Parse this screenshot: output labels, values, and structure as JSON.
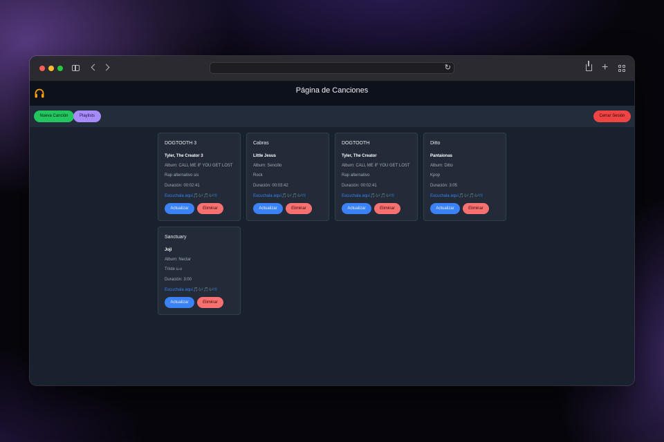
{
  "browser": {
    "traffic_lights": [
      "#fe5f57",
      "#febc2e",
      "#28c840"
    ],
    "address": "",
    "icons": [
      "sidebar-icon",
      "back-chevron-icon",
      "forward-chevron-icon",
      "reload-icon",
      "share-icon",
      "new-tab-icon",
      "tab-overview-icon"
    ]
  },
  "header": {
    "title": "Página de Canciones",
    "logo_icon": "headphones-icon",
    "logo_color": "#f59e0b"
  },
  "nav": {
    "new_song": "Nueva Canción",
    "playlists": "Playlists",
    "logout": "Cerrar Sesión"
  },
  "colors": {
    "new_song": "#22c55e",
    "playlists": "#a78bfa",
    "logout": "#ef4444",
    "update": "#3b82f6",
    "delete": "#f87171",
    "link": "#3b82f6"
  },
  "songs": [
    {
      "title": "DOGTOOTH 3",
      "artist": "Tyler, The Creator 3",
      "album": "Album: CALL ME IF YOU GET LOST",
      "genre": "Rap alternativo sis",
      "duration": "Duración: 00:02:41",
      "listen": "Escuchala aquí🎵🎶🎵🎶!!!",
      "update": "Actualizar",
      "delete": "Eliminar"
    },
    {
      "title": "Cabras",
      "artist": "Little Jesus",
      "album": "Album: Sencillo",
      "genre": "Rock",
      "duration": "Duración: 00:03:42",
      "listen": "Escuchala aquí🎵🎶🎵🎶!!!",
      "update": "Actualizar",
      "delete": "Eliminar"
    },
    {
      "title": "DOGTOOTH",
      "artist": "Tyler, The Creator",
      "album": "Album: CALL ME IF YOU GET LOST",
      "genre": "Rap alternativo",
      "duration": "Duración: 00:02:41",
      "listen": "Escuchala aquí🎵🎶🎵🎶!!!",
      "update": "Actualizar",
      "delete": "Eliminar"
    },
    {
      "title": "Ditto",
      "artist": "Pantaionas",
      "album": "Album: Ditto",
      "genre": "Kpop",
      "duration": "Duración: 3:05",
      "listen": "Escuchala aquí🎵🎶🎵🎶!!!",
      "update": "Actualizar",
      "delete": "Eliminar"
    },
    {
      "title": "Sanctuary",
      "artist": "Joji",
      "album": "Album: Nectar",
      "genre": "Triste u.u",
      "duration": "Duración: 3:00",
      "listen": "Escuchala aquí🎵🎶🎵🎶!!!",
      "update": "Actualizar",
      "delete": "Eliminar"
    }
  ]
}
